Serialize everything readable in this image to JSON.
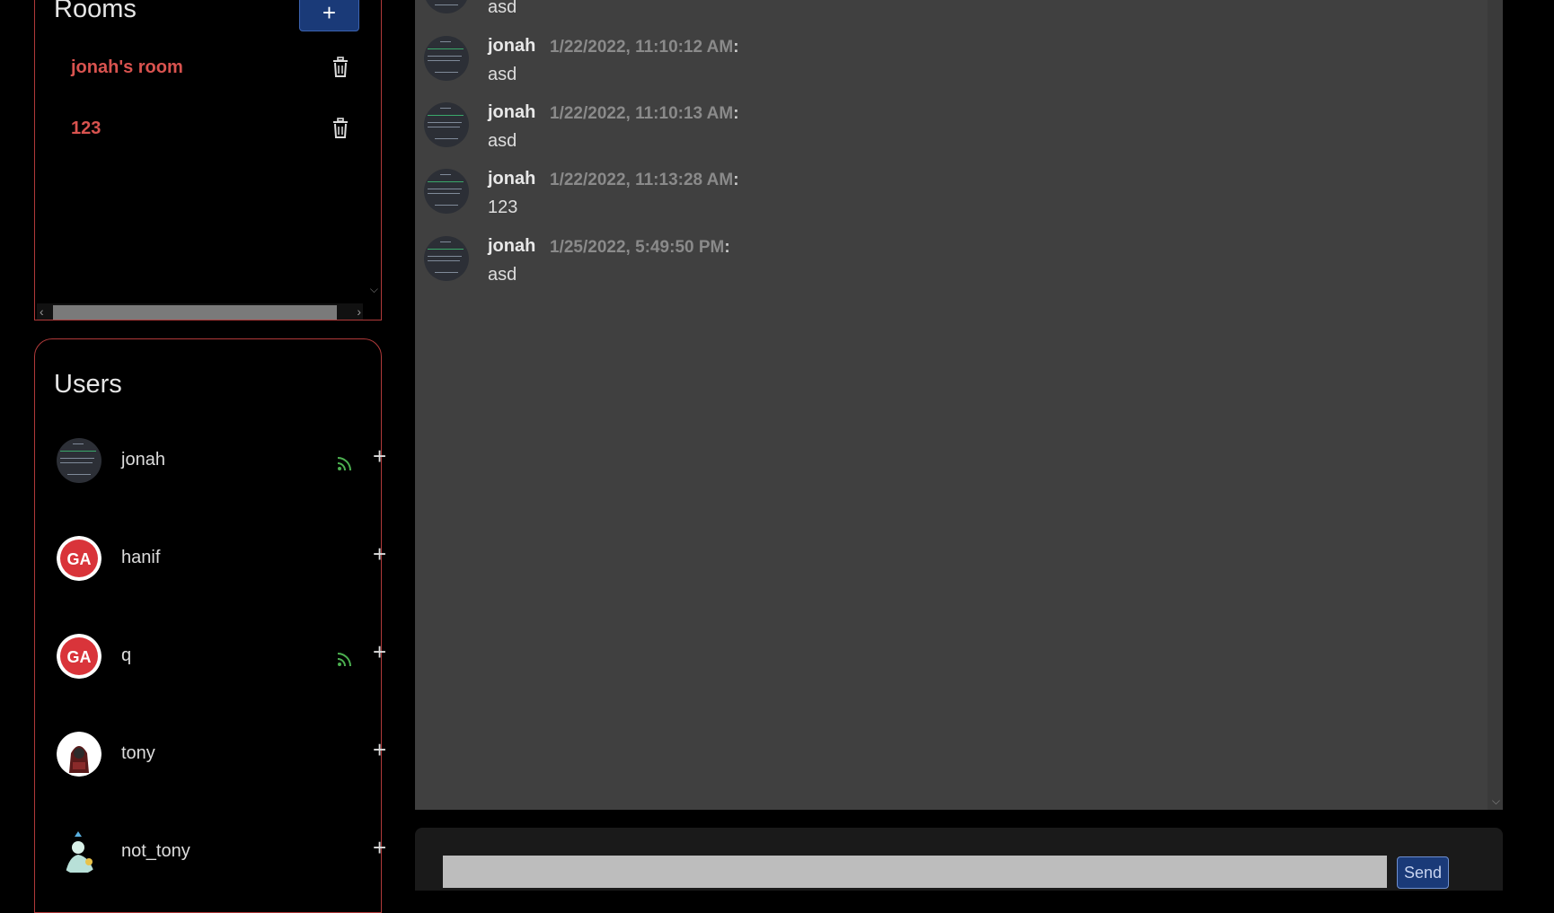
{
  "rooms": {
    "title": "Rooms",
    "add_label": "+",
    "items": [
      {
        "label": "jonah's room"
      },
      {
        "label": "123"
      }
    ]
  },
  "users": {
    "title": "Users",
    "add_label": "+",
    "items": [
      {
        "name": "jonah",
        "online": true,
        "avatar": "screenshot-avatar"
      },
      {
        "name": "hanif",
        "online": false,
        "avatar": "ga-logo-avatar"
      },
      {
        "name": "q",
        "online": true,
        "avatar": "ga-logo-avatar"
      },
      {
        "name": "tony",
        "online": false,
        "avatar": "hooded-figure-avatar"
      },
      {
        "name": "not_tony",
        "online": false,
        "avatar": "character-avatar"
      }
    ]
  },
  "chat": {
    "messages": [
      {
        "author": "",
        "time": "",
        "text": "asd"
      },
      {
        "author": "jonah",
        "time": "1/22/2022, 11:10:12 AM",
        "text": "asd"
      },
      {
        "author": "jonah",
        "time": "1/22/2022, 11:10:13 AM",
        "text": "asd"
      },
      {
        "author": "jonah",
        "time": "1/22/2022, 11:13:28 AM",
        "text": "123"
      },
      {
        "author": "jonah",
        "time": "1/25/2022, 5:49:50 PM",
        "text": "asd"
      }
    ],
    "colon": ":"
  },
  "composer": {
    "value": "",
    "send_label": "Send"
  },
  "colors": {
    "accent_red": "#d9534f",
    "border_red": "#b03a3a",
    "button_blue": "#1a3a78",
    "online_green": "#4caf50",
    "chat_bg": "#404040"
  }
}
